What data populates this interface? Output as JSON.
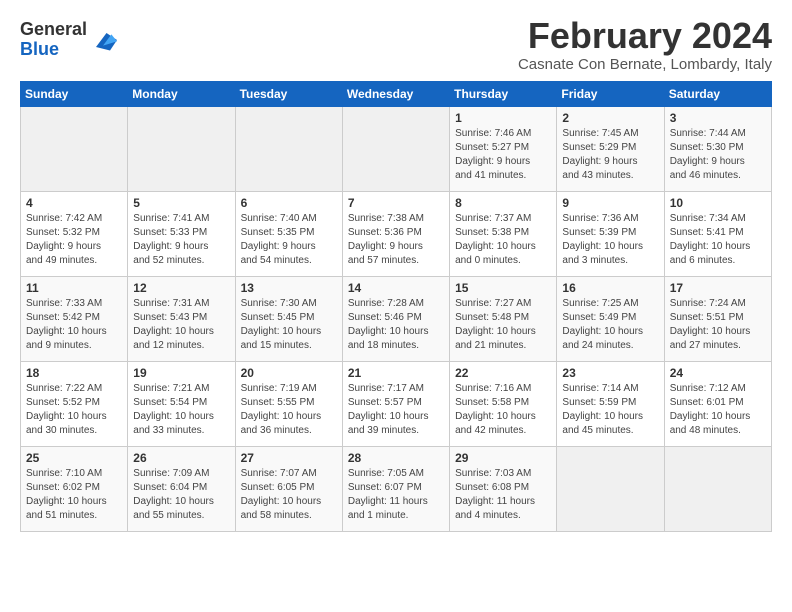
{
  "header": {
    "logo_line1": "General",
    "logo_line2": "Blue",
    "month_title": "February 2024",
    "location": "Casnate Con Bernate, Lombardy, Italy"
  },
  "weekdays": [
    "Sunday",
    "Monday",
    "Tuesday",
    "Wednesday",
    "Thursday",
    "Friday",
    "Saturday"
  ],
  "weeks": [
    [
      {
        "day": "",
        "info": ""
      },
      {
        "day": "",
        "info": ""
      },
      {
        "day": "",
        "info": ""
      },
      {
        "day": "",
        "info": ""
      },
      {
        "day": "1",
        "info": "Sunrise: 7:46 AM\nSunset: 5:27 PM\nDaylight: 9 hours\nand 41 minutes."
      },
      {
        "day": "2",
        "info": "Sunrise: 7:45 AM\nSunset: 5:29 PM\nDaylight: 9 hours\nand 43 minutes."
      },
      {
        "day": "3",
        "info": "Sunrise: 7:44 AM\nSunset: 5:30 PM\nDaylight: 9 hours\nand 46 minutes."
      }
    ],
    [
      {
        "day": "4",
        "info": "Sunrise: 7:42 AM\nSunset: 5:32 PM\nDaylight: 9 hours\nand 49 minutes."
      },
      {
        "day": "5",
        "info": "Sunrise: 7:41 AM\nSunset: 5:33 PM\nDaylight: 9 hours\nand 52 minutes."
      },
      {
        "day": "6",
        "info": "Sunrise: 7:40 AM\nSunset: 5:35 PM\nDaylight: 9 hours\nand 54 minutes."
      },
      {
        "day": "7",
        "info": "Sunrise: 7:38 AM\nSunset: 5:36 PM\nDaylight: 9 hours\nand 57 minutes."
      },
      {
        "day": "8",
        "info": "Sunrise: 7:37 AM\nSunset: 5:38 PM\nDaylight: 10 hours\nand 0 minutes."
      },
      {
        "day": "9",
        "info": "Sunrise: 7:36 AM\nSunset: 5:39 PM\nDaylight: 10 hours\nand 3 minutes."
      },
      {
        "day": "10",
        "info": "Sunrise: 7:34 AM\nSunset: 5:41 PM\nDaylight: 10 hours\nand 6 minutes."
      }
    ],
    [
      {
        "day": "11",
        "info": "Sunrise: 7:33 AM\nSunset: 5:42 PM\nDaylight: 10 hours\nand 9 minutes."
      },
      {
        "day": "12",
        "info": "Sunrise: 7:31 AM\nSunset: 5:43 PM\nDaylight: 10 hours\nand 12 minutes."
      },
      {
        "day": "13",
        "info": "Sunrise: 7:30 AM\nSunset: 5:45 PM\nDaylight: 10 hours\nand 15 minutes."
      },
      {
        "day": "14",
        "info": "Sunrise: 7:28 AM\nSunset: 5:46 PM\nDaylight: 10 hours\nand 18 minutes."
      },
      {
        "day": "15",
        "info": "Sunrise: 7:27 AM\nSunset: 5:48 PM\nDaylight: 10 hours\nand 21 minutes."
      },
      {
        "day": "16",
        "info": "Sunrise: 7:25 AM\nSunset: 5:49 PM\nDaylight: 10 hours\nand 24 minutes."
      },
      {
        "day": "17",
        "info": "Sunrise: 7:24 AM\nSunset: 5:51 PM\nDaylight: 10 hours\nand 27 minutes."
      }
    ],
    [
      {
        "day": "18",
        "info": "Sunrise: 7:22 AM\nSunset: 5:52 PM\nDaylight: 10 hours\nand 30 minutes."
      },
      {
        "day": "19",
        "info": "Sunrise: 7:21 AM\nSunset: 5:54 PM\nDaylight: 10 hours\nand 33 minutes."
      },
      {
        "day": "20",
        "info": "Sunrise: 7:19 AM\nSunset: 5:55 PM\nDaylight: 10 hours\nand 36 minutes."
      },
      {
        "day": "21",
        "info": "Sunrise: 7:17 AM\nSunset: 5:57 PM\nDaylight: 10 hours\nand 39 minutes."
      },
      {
        "day": "22",
        "info": "Sunrise: 7:16 AM\nSunset: 5:58 PM\nDaylight: 10 hours\nand 42 minutes."
      },
      {
        "day": "23",
        "info": "Sunrise: 7:14 AM\nSunset: 5:59 PM\nDaylight: 10 hours\nand 45 minutes."
      },
      {
        "day": "24",
        "info": "Sunrise: 7:12 AM\nSunset: 6:01 PM\nDaylight: 10 hours\nand 48 minutes."
      }
    ],
    [
      {
        "day": "25",
        "info": "Sunrise: 7:10 AM\nSunset: 6:02 PM\nDaylight: 10 hours\nand 51 minutes."
      },
      {
        "day": "26",
        "info": "Sunrise: 7:09 AM\nSunset: 6:04 PM\nDaylight: 10 hours\nand 55 minutes."
      },
      {
        "day": "27",
        "info": "Sunrise: 7:07 AM\nSunset: 6:05 PM\nDaylight: 10 hours\nand 58 minutes."
      },
      {
        "day": "28",
        "info": "Sunrise: 7:05 AM\nSunset: 6:07 PM\nDaylight: 11 hours\nand 1 minute."
      },
      {
        "day": "29",
        "info": "Sunrise: 7:03 AM\nSunset: 6:08 PM\nDaylight: 11 hours\nand 4 minutes."
      },
      {
        "day": "",
        "info": ""
      },
      {
        "day": "",
        "info": ""
      }
    ]
  ]
}
